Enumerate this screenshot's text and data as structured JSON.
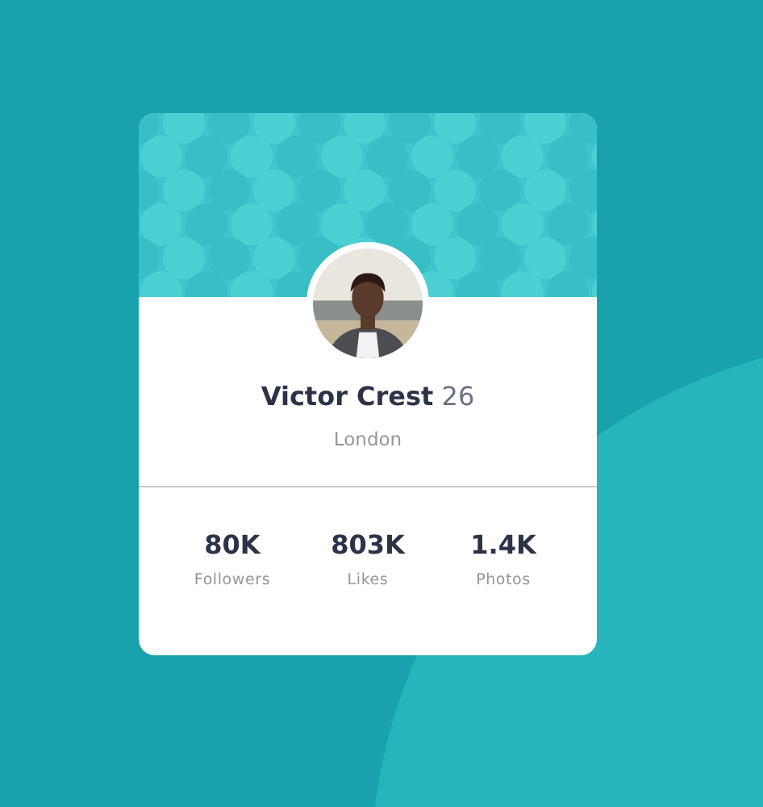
{
  "profile": {
    "name": "Victor Crest",
    "age": "26",
    "location": "London"
  },
  "stats": [
    {
      "value": "80K",
      "label": "Followers"
    },
    {
      "value": "803K",
      "label": "Likes"
    },
    {
      "value": "1.4K",
      "label": "Photos"
    }
  ]
}
